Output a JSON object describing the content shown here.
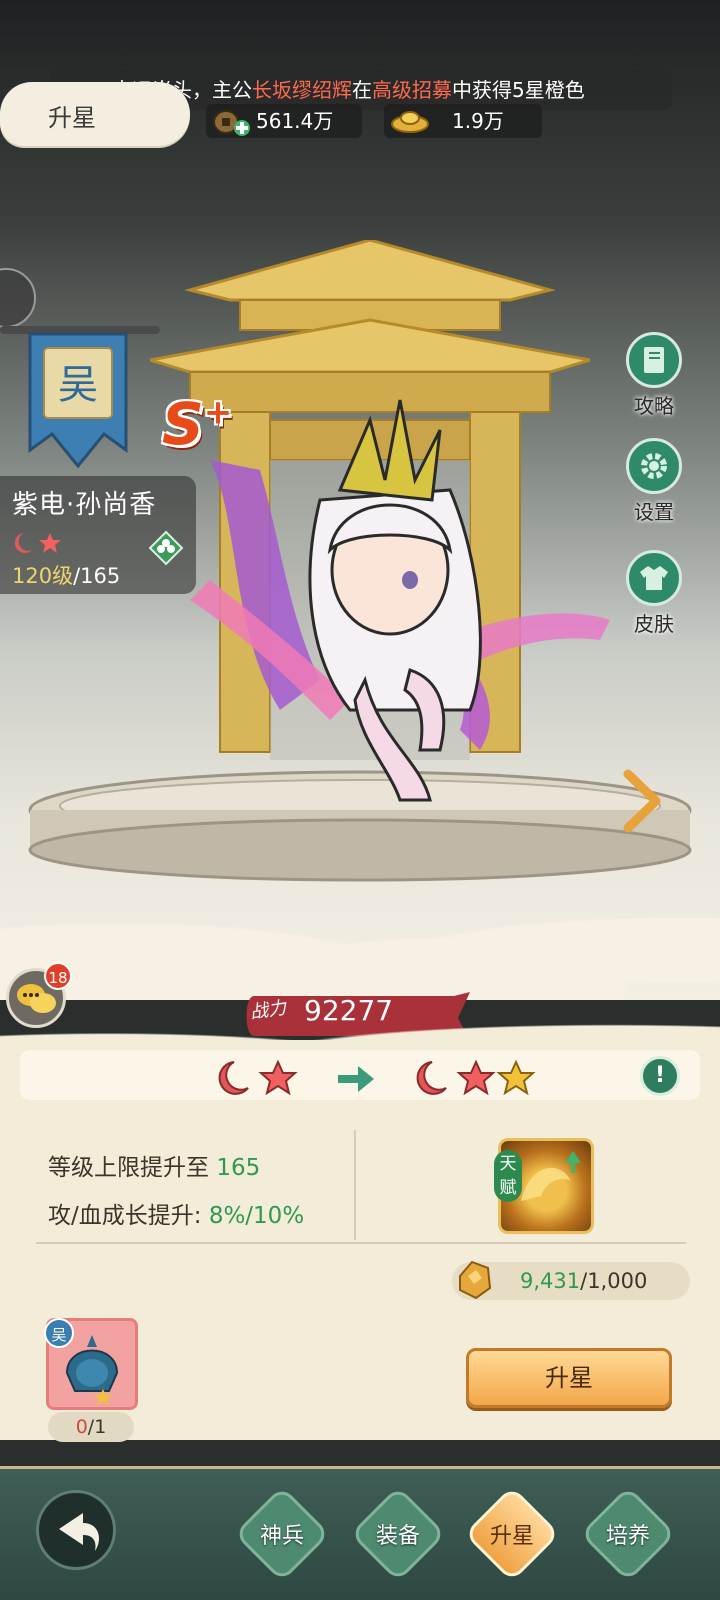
{
  "announcement": {
    "prefix": "吉运当头，主公",
    "player": "长坂缪绍辉",
    "mid": "在",
    "event": "高级招募",
    "suffix": "中获得5星橙色"
  },
  "header": {
    "title": "升星"
  },
  "resources": [
    {
      "icon": "copper-coin-icon",
      "value": "561.4万"
    },
    {
      "icon": "gold-ingot-icon",
      "value": "1.9万"
    }
  ],
  "hero": {
    "faction": "吴",
    "name": "紫电·孙尚香",
    "rank": "S",
    "rank_plus": "+",
    "level_current": "120级",
    "level_max": "/165",
    "stars": 2
  },
  "side_buttons": [
    {
      "label": "攻略",
      "icon": "guide-book-icon"
    },
    {
      "label": "设置",
      "icon": "settings-gear-icon"
    },
    {
      "label": "皮肤",
      "icon": "skin-shirt-icon"
    }
  ],
  "chat": {
    "badge": "18"
  },
  "power": {
    "label": "战力",
    "value": "92277"
  },
  "star_upgrade": {
    "from_stars": 2,
    "to_stars": 3,
    "stat_1_label": "等级上限提升至 ",
    "stat_1_value": "165",
    "stat_2_label": "攻/血成长提升: ",
    "stat_2_value": "8%/10%",
    "talent_tag": "天赋",
    "material_current": "9,431",
    "material_required": "/1,000",
    "fragment_faction": "吴",
    "fragment_current": "0",
    "fragment_required": "/1",
    "upgrade_button": "升星"
  },
  "bottom_nav": {
    "tabs": [
      {
        "label": "神兵",
        "active": false
      },
      {
        "label": "装备",
        "active": false
      },
      {
        "label": "升星",
        "active": true
      },
      {
        "label": "培养",
        "active": false
      }
    ]
  },
  "colors": {
    "highlight_red": "#ff6a4e",
    "stat_green": "#2f9a4e",
    "button_orange": "#f3a74a",
    "nav_green": "#3f5e56"
  }
}
